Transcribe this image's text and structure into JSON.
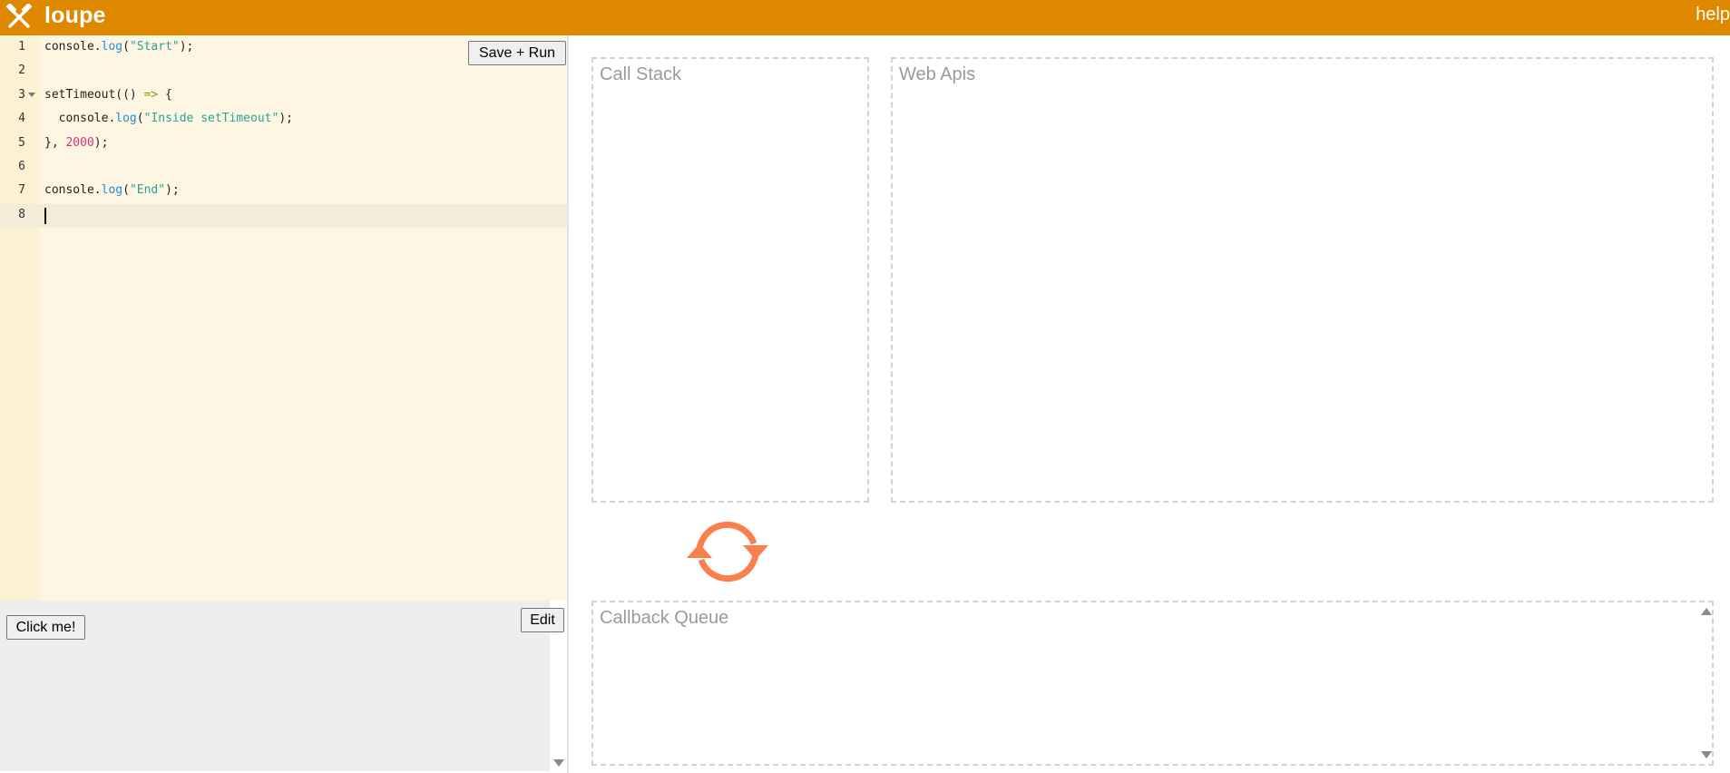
{
  "header": {
    "app_title": "loupe",
    "help_label": "help",
    "logo_icon": "tools-hammer-icon"
  },
  "colors": {
    "header_bg": "#de8800",
    "editor_bg": "#fdf6e3",
    "loop_accent": "#f9804c"
  },
  "editor": {
    "save_run_label": "Save + Run",
    "active_line": "8",
    "lines": [
      {
        "n": "1",
        "parts": [
          [
            "console.",
            ""
          ],
          [
            "log",
            "fn"
          ],
          [
            "(",
            ""
          ],
          [
            "\"Start\"",
            "str"
          ],
          [
            ");",
            ""
          ]
        ]
      },
      {
        "n": "2",
        "parts": []
      },
      {
        "n": "3",
        "parts": [
          [
            "setTimeout(() ",
            ""
          ],
          [
            "=>",
            "op"
          ],
          [
            " {",
            ""
          ]
        ]
      },
      {
        "n": "4",
        "parts": [
          [
            "  console.",
            ""
          ],
          [
            "log",
            "fn"
          ],
          [
            "(",
            ""
          ],
          [
            "\"Inside setTimeout\"",
            "str"
          ],
          [
            ");",
            ""
          ]
        ]
      },
      {
        "n": "5",
        "parts": [
          [
            "}, ",
            ""
          ],
          [
            "2000",
            "num"
          ],
          [
            ");",
            ""
          ]
        ]
      },
      {
        "n": "6",
        "parts": []
      },
      {
        "n": "7",
        "parts": [
          [
            "console.",
            ""
          ],
          [
            "log",
            "fn"
          ],
          [
            "(",
            ""
          ],
          [
            "\"End\"",
            "str"
          ],
          [
            ");",
            ""
          ]
        ]
      },
      {
        "n": "8",
        "parts": []
      }
    ]
  },
  "preview": {
    "click_me_label": "Click me!",
    "edit_label": "Edit"
  },
  "panels": {
    "call_stack": "Call Stack",
    "web_apis": "Web Apis",
    "callback_queue": "Callback Queue"
  },
  "event_loop": {
    "icon": "refresh-loop-icon"
  }
}
